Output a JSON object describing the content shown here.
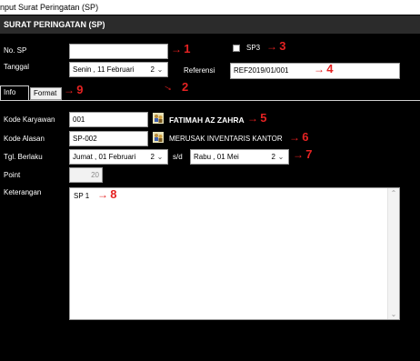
{
  "window": {
    "title": "nput Surat Peringatan (SP)"
  },
  "header": {
    "title": "SURAT PERINGATAN (SP)"
  },
  "form": {
    "no_sp_label": "No. SP",
    "no_sp_value": "",
    "tanggal_label": "Tanggal",
    "tanggal_value": "Senin , 11   Februari",
    "tanggal_stub": "2",
    "sp3_label": "SP3",
    "referensi_label": "Referensi",
    "referensi_value": "REF2019/01/001"
  },
  "tabs": {
    "info": "Info",
    "format": "Format"
  },
  "info": {
    "kode_karyawan_label": "Kode Karyawan",
    "kode_karyawan_value": "001",
    "karyawan_name": "FATIMAH AZ ZAHRA",
    "kode_alasan_label": "Kode Alasan",
    "kode_alasan_value": "SP-002",
    "alasan_name": "MERUSAK INVENTARIS KANTOR",
    "tgl_berlaku_label": "Tgl. Berlaku",
    "tgl_berlaku_from": "Jumat , 01   Februari",
    "tgl_berlaku_from_stub": "2",
    "sd_label": "s/d",
    "tgl_berlaku_to": "Rabu , 01       Mei",
    "tgl_berlaku_to_stub": "2",
    "point_label": "Point",
    "point_value": "20",
    "keterangan_label": "Keterangan",
    "keterangan_value": "SP 1"
  },
  "annotations": {
    "arrow": "→",
    "n1": "1",
    "n2": "2",
    "n3": "3",
    "n4": "4",
    "n5": "5",
    "n6": "6",
    "n7": "7",
    "n8": "8",
    "n9": "9"
  },
  "icons": {
    "dropdown": "chevron-down-icon",
    "lookup": "person-lookup-icon",
    "scroll_up": "scroll-up-icon",
    "scroll_down": "scroll-down-icon"
  },
  "colors": {
    "annotation": "#e52222",
    "background": "#000000",
    "header": "#2b2b2b"
  }
}
